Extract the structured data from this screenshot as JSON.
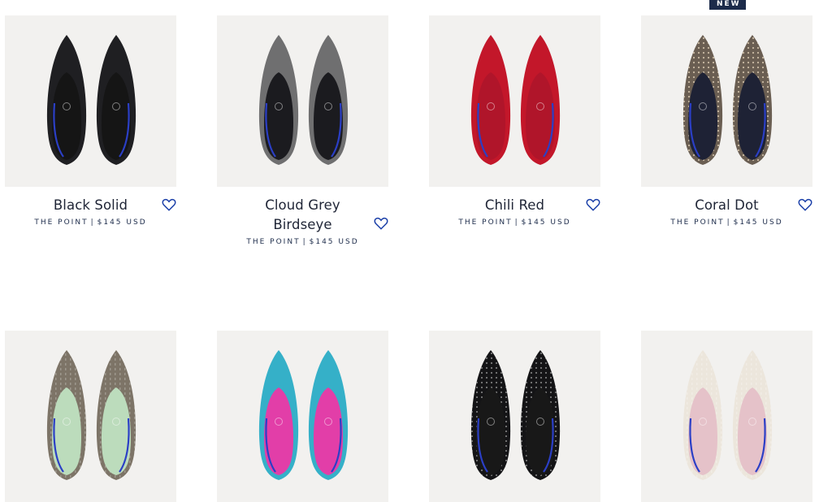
{
  "products": [
    {
      "name": "Black Solid",
      "style": "THE POINT",
      "price": "$145 USD",
      "badge": "",
      "upper": "#1f1f22",
      "lining": "#151515",
      "pattern": "none"
    },
    {
      "name": "Cloud Grey Birdseye",
      "style": "THE POINT",
      "price": "$145 USD",
      "badge": "",
      "upper": "#6f6f70",
      "lining": "#1b1b1f",
      "pattern": "none"
    },
    {
      "name": "Chili Red",
      "style": "THE POINT",
      "price": "$145 USD",
      "badge": "",
      "upper": "#c3172a",
      "lining": "#b0152a",
      "pattern": "none"
    },
    {
      "name": "Coral Dot",
      "style": "THE POINT",
      "price": "$145 USD",
      "badge": "NEW",
      "upper": "#6a5e52",
      "lining": "#1e2235",
      "pattern": "dots"
    },
    {
      "name": "",
      "style": "",
      "price": "",
      "badge": "",
      "upper": "#7d7467",
      "lining": "#bcdcbc",
      "pattern": "knit"
    },
    {
      "name": "",
      "style": "",
      "price": "",
      "badge": "",
      "upper": "#35b0c8",
      "lining": "#e23ea8",
      "pattern": "none"
    },
    {
      "name": "",
      "style": "",
      "price": "",
      "badge": "",
      "upper": "#141416",
      "lining": "#181818",
      "pattern": "dots-light"
    },
    {
      "name": "",
      "style": "",
      "price": "",
      "badge": "",
      "upper": "#ece6dc",
      "lining": "#e5c2c9",
      "pattern": "knit"
    }
  ],
  "separator": "|"
}
